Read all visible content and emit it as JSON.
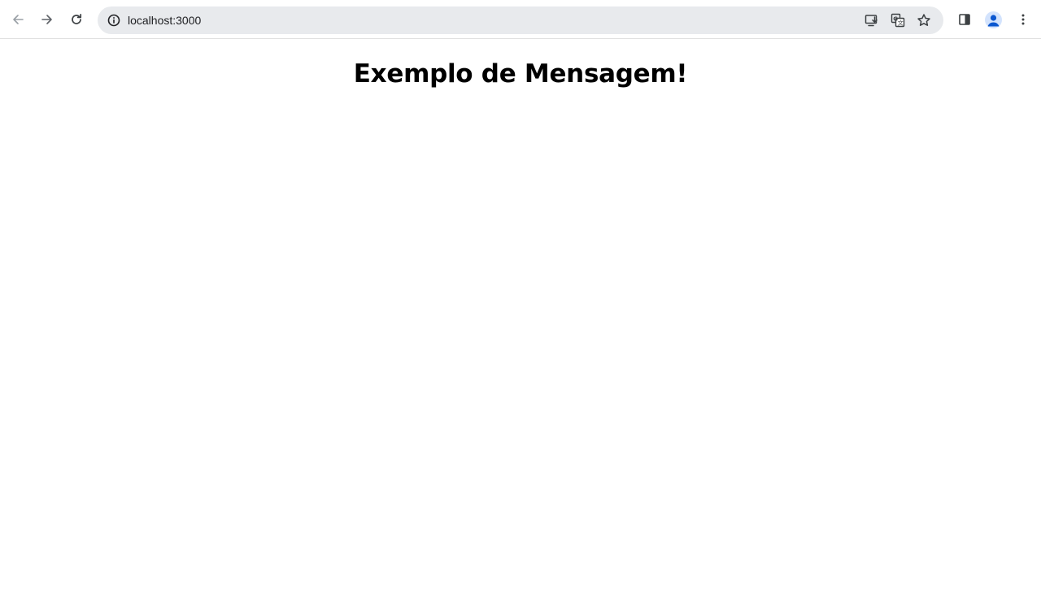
{
  "browser": {
    "address_bar": {
      "url": "localhost:3000"
    },
    "icons": {
      "back": "arrow-left-icon",
      "forward": "arrow-right-icon",
      "reload": "reload-icon",
      "site_info": "info-circle-icon",
      "install_app": "install-app-icon",
      "translate": "translate-icon",
      "bookmark": "star-icon",
      "side_panel": "side-panel-icon",
      "profile": "profile-avatar-icon",
      "menu": "kebab-menu-icon"
    },
    "colors": {
      "omnibox_bg": "#e8eaed",
      "accent": "#1a73e8"
    }
  },
  "page": {
    "heading": "Exemplo de Mensagem!"
  }
}
